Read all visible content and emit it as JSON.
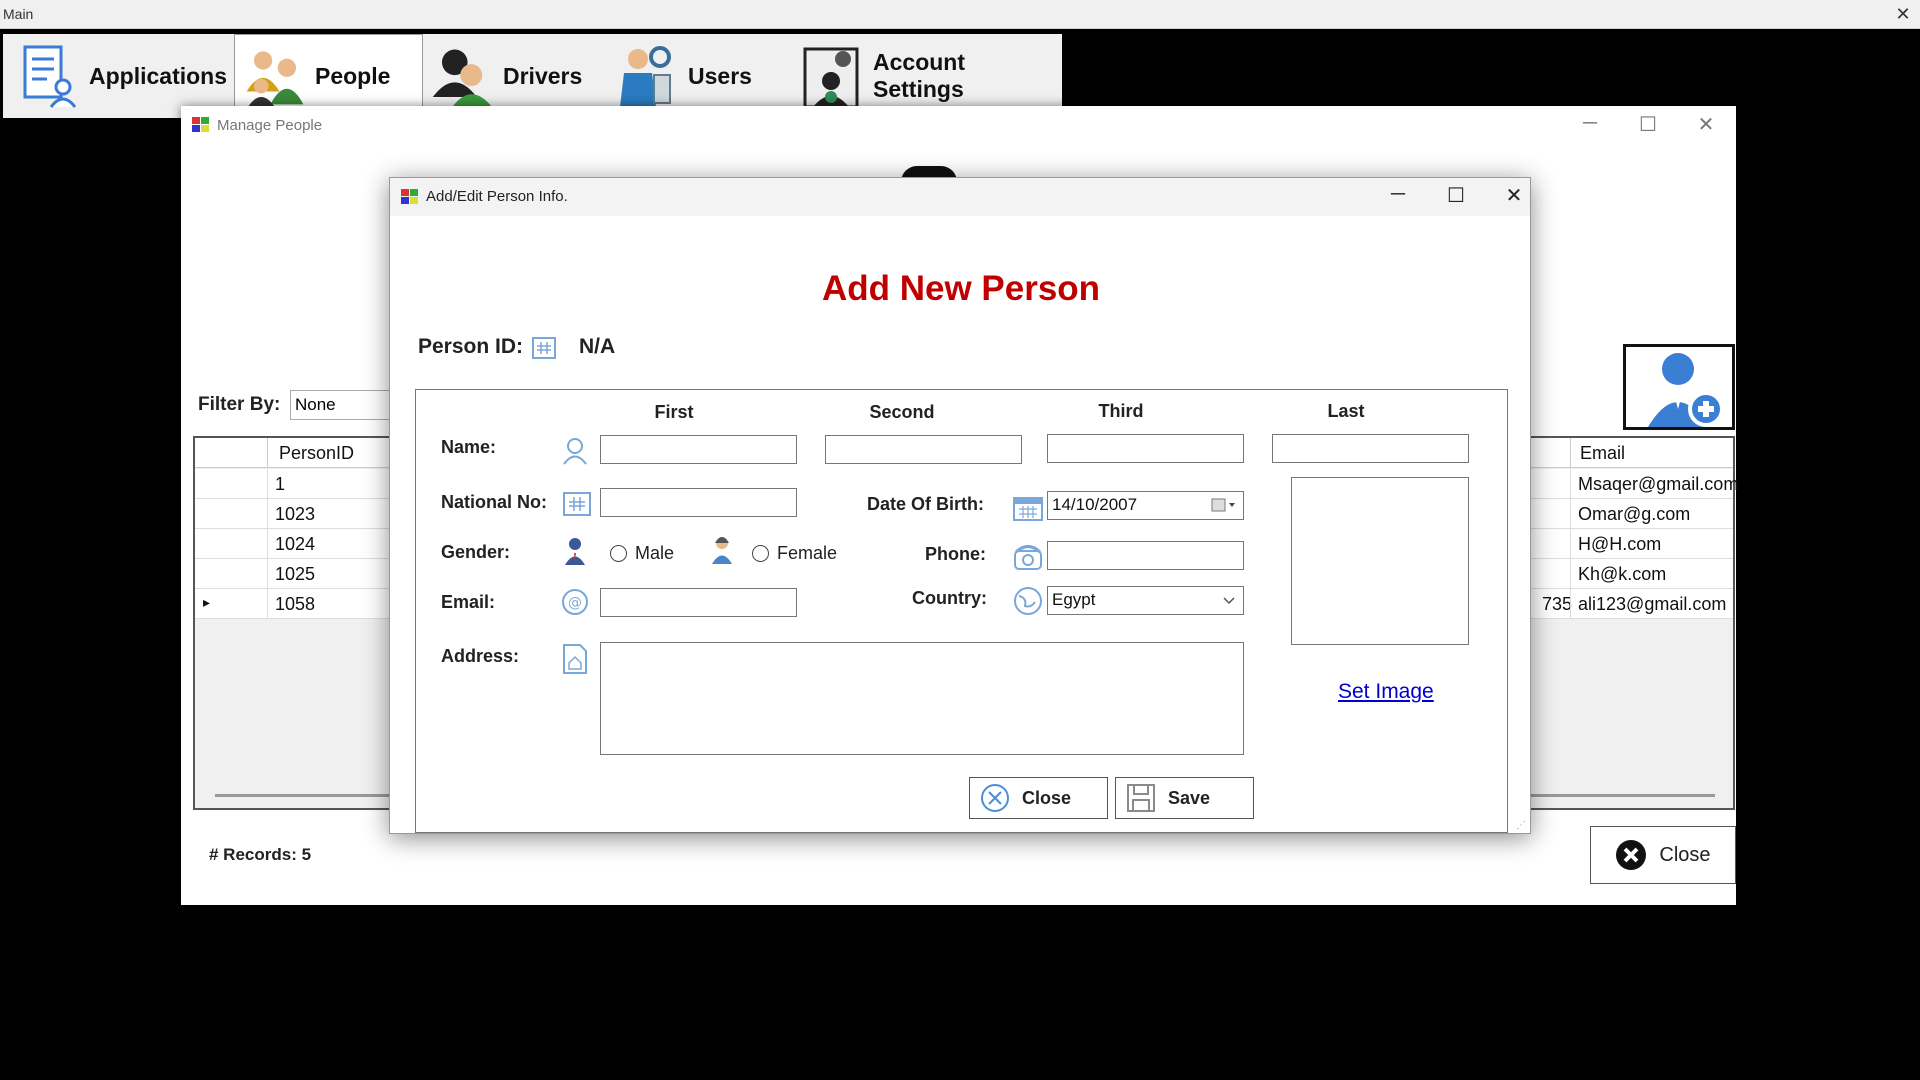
{
  "main": {
    "title": "Main",
    "close_glyph": "✕",
    "menu": [
      {
        "label": "Applications",
        "icon": "applications-icon"
      },
      {
        "label": "People",
        "icon": "people-icon"
      },
      {
        "label": "Drivers",
        "icon": "drivers-icon"
      },
      {
        "label": "Users",
        "icon": "users-icon"
      },
      {
        "label": "Account Settings",
        "icon": "account-settings-icon"
      }
    ]
  },
  "manage_people": {
    "title": "Manage People",
    "filter_label": "Filter By:",
    "filter_value": "None",
    "grid": {
      "columns": [
        "PersonID",
        "Email"
      ],
      "rows": [
        {
          "id": "1",
          "email": "Msaqer@gmail.com",
          "extra": ""
        },
        {
          "id": "1023",
          "email": "Omar@g.com",
          "extra": ""
        },
        {
          "id": "1024",
          "email": "H@H.com",
          "extra": ""
        },
        {
          "id": "1025",
          "email": "Kh@k.com",
          "extra": ""
        },
        {
          "id": "1058",
          "email": "ali123@gmail.com",
          "extra": "735"
        }
      ],
      "selected_row_marker": "▸"
    },
    "records_label": "# Records: 5",
    "close_label": "Close"
  },
  "dialog": {
    "title": "Add/Edit Person Info.",
    "heading": "Add New Person",
    "person_id_label": "Person ID:",
    "person_id_value": "N/A",
    "columns": {
      "first": "First",
      "second": "Second",
      "third": "Third",
      "last": "Last"
    },
    "labels": {
      "name": "Name:",
      "national_no": "National No:",
      "gender": "Gender:",
      "email": "Email:",
      "address": "Address:",
      "date_of_birth": "Date Of Birth:",
      "phone": "Phone:",
      "country": "Country:"
    },
    "gender_options": {
      "male": "Male",
      "female": "Female"
    },
    "values": {
      "first": "",
      "second": "",
      "third": "",
      "last": "",
      "national_no": "",
      "email": "",
      "phone": "",
      "address": "",
      "date_of_birth": "14/10/2007",
      "country": "Egypt"
    },
    "set_image_link": "Set Image",
    "close_button": "Close",
    "save_button": "Save",
    "colors": {
      "heading": "#c00000",
      "link": "#0000cc"
    }
  }
}
